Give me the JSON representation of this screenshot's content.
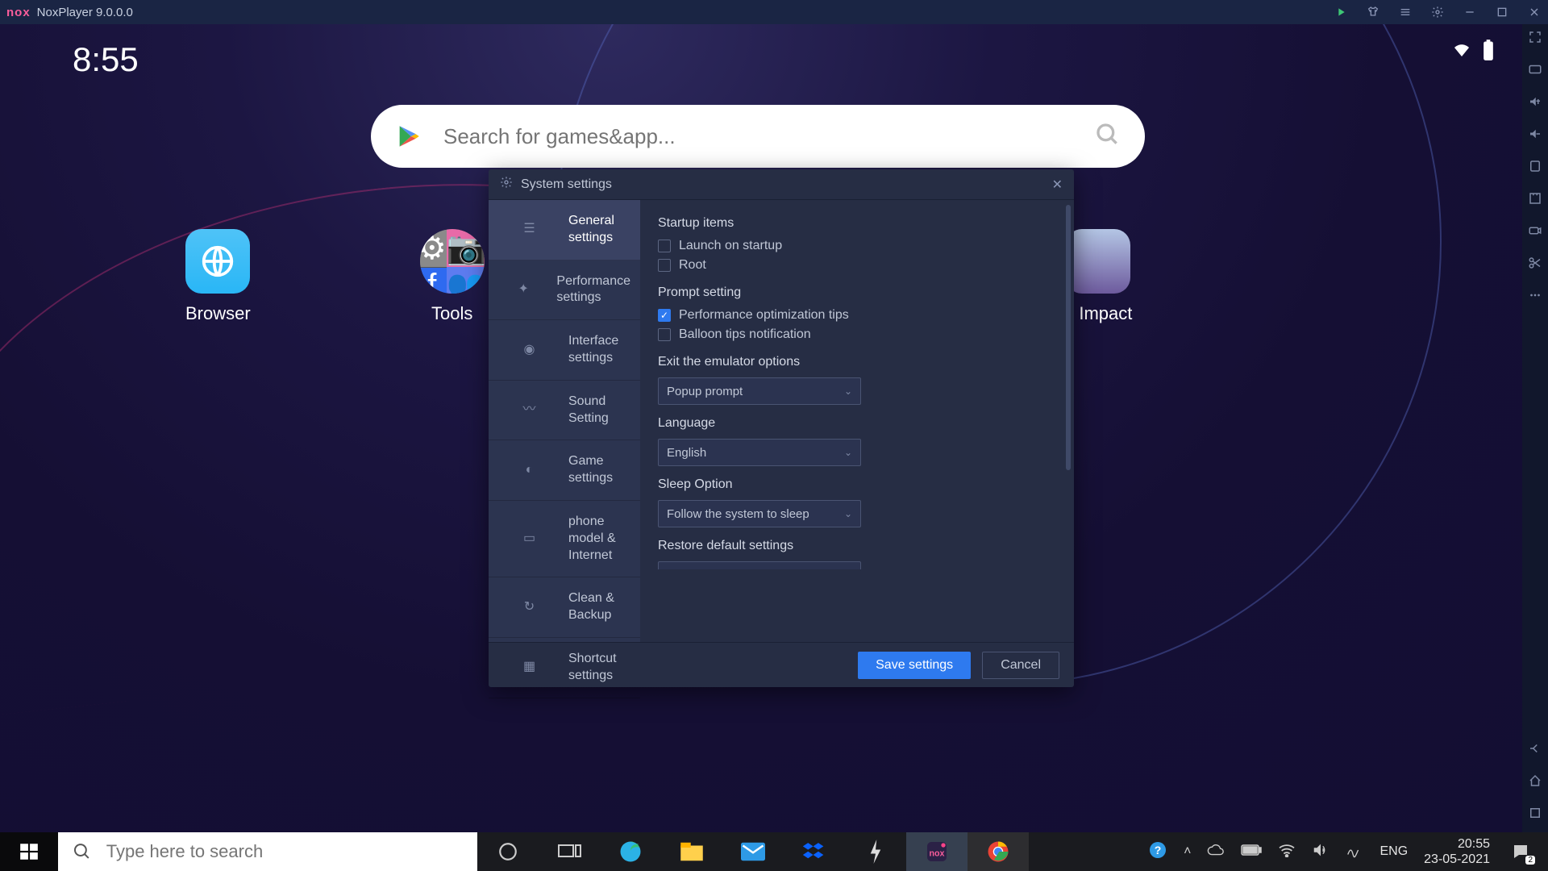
{
  "titlebar": {
    "app_name": "NoxPlayer 9.0.0.0",
    "logo": "nox"
  },
  "clock": "8:55",
  "search": {
    "placeholder": "Search for games&app..."
  },
  "home": {
    "browser": "Browser",
    "tools": "Tools",
    "genshin": "n Impact"
  },
  "dialog": {
    "title": "System settings",
    "sidebar": [
      "General settings",
      "Performance settings",
      "Interface settings",
      "Sound Setting",
      "Game settings",
      "phone model & Internet",
      "Clean & Backup",
      "Shortcut settings"
    ],
    "sections": {
      "startup_title": "Startup items",
      "launch_startup": "Launch on startup",
      "root": "Root",
      "prompt_title": "Prompt setting",
      "perf_tips": "Performance optimization tips",
      "balloon": "Balloon tips notification",
      "exit_title": "Exit the emulator options",
      "exit_value": "Popup prompt",
      "lang_title": "Language",
      "lang_value": "English",
      "sleep_title": "Sleep Option",
      "sleep_value": "Follow the system to sleep",
      "restore_title": "Restore default settings"
    },
    "buttons": {
      "save": "Save settings",
      "cancel": "Cancel"
    }
  },
  "taskbar": {
    "search_placeholder": "Type here to search",
    "lang": "ENG",
    "time": "20:55",
    "date": "23-05-2021",
    "notify_count": "2"
  }
}
